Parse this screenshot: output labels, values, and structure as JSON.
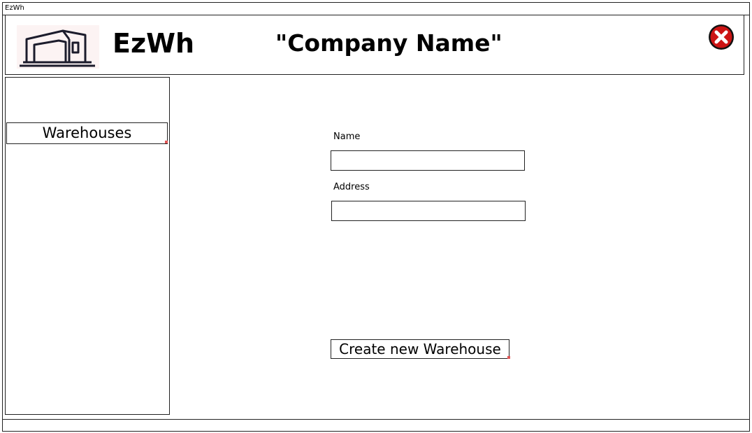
{
  "window": {
    "title": "EzWh"
  },
  "header": {
    "logo_icon": "warehouse-logo-icon",
    "app_name": "EzWh",
    "company_name": "\"Company Name\"",
    "close_icon": "close-icon",
    "close_color": "#cc1414"
  },
  "sidebar": {
    "items": [
      {
        "label": "Warehouses"
      }
    ]
  },
  "form": {
    "name_label": "Name",
    "name_value": "",
    "address_label": "Address",
    "address_value": "",
    "submit_label": "Create new Warehouse"
  }
}
